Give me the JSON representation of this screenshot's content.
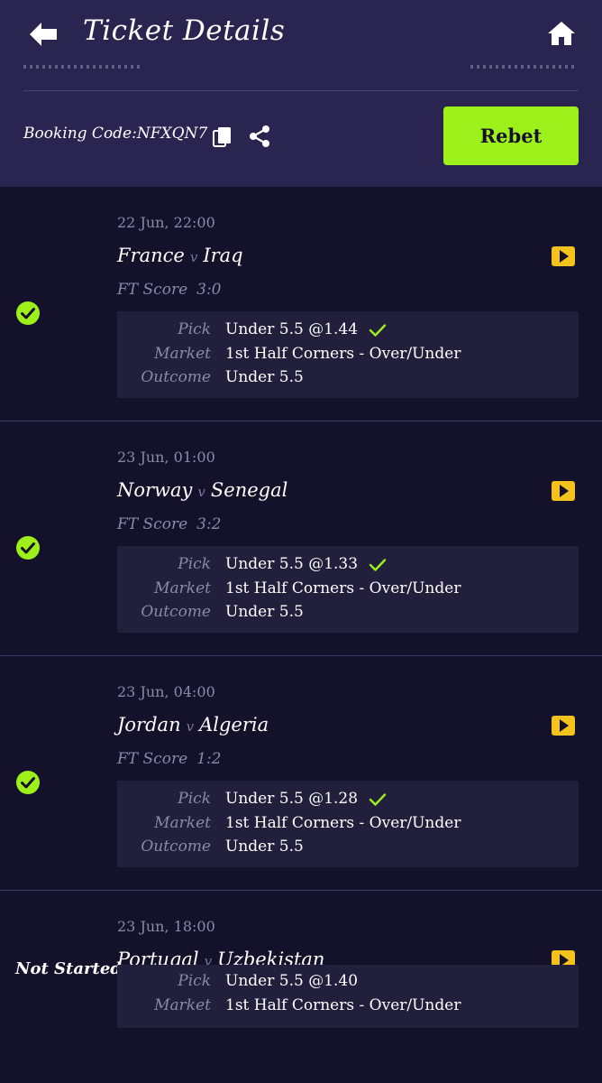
{
  "header": {
    "title": "Ticket Details"
  },
  "summary": {
    "booking_label": "Booking Code:",
    "booking_code": "NFXQN7",
    "rebet_label": "Rebet"
  },
  "matches": [
    {
      "status": "won",
      "kickoff": "22 Jun, 22:00",
      "home": "France",
      "away": "Iraq",
      "vs": "v",
      "ft_label": "FT Score",
      "ft_score": "3:0",
      "pick_label": "Pick",
      "pick": "Under 5.5 @1.44",
      "market_label": "Market",
      "market": "1st Half Corners - Over/Under",
      "outcome_label": "Outcome",
      "outcome": "Under 5.5"
    },
    {
      "status": "won",
      "kickoff": "23 Jun, 01:00",
      "home": "Norway",
      "away": "Senegal",
      "vs": "v",
      "ft_label": "FT Score",
      "ft_score": "3:2",
      "pick_label": "Pick",
      "pick": "Under 5.5 @1.33",
      "market_label": "Market",
      "market": "1st Half Corners - Over/Under",
      "outcome_label": "Outcome",
      "outcome": "Under 5.5"
    },
    {
      "status": "won",
      "kickoff": "23 Jun, 04:00",
      "home": "Jordan",
      "away": "Algeria",
      "vs": "v",
      "ft_label": "FT Score",
      "ft_score": "1:2",
      "pick_label": "Pick",
      "pick": "Under 5.5 @1.28",
      "market_label": "Market",
      "market": "1st Half Corners - Over/Under",
      "outcome_label": "Outcome",
      "outcome": "Under 5.5"
    },
    {
      "status": "not_started",
      "status_text": "Not Started",
      "kickoff": "23 Jun, 18:00",
      "home": "Portugal",
      "away": "Uzbekistan",
      "vs": "v",
      "pick_label": "Pick",
      "pick": "Under 5.5 @1.40",
      "market_label": "Market",
      "market": "1st Half Corners - Over/Under"
    }
  ],
  "colors": {
    "header_bg": "#2a2550",
    "page_bg": "#14122a",
    "accent_green": "#9ef01a",
    "expand_yellow": "#f4c21a",
    "muted_text": "#8c89a8"
  },
  "icons": {
    "back": "arrow-left-icon",
    "home": "home-icon",
    "copy": "copy-icon",
    "share": "share-icon",
    "won": "check-circle-icon",
    "pick_ok": "check-icon",
    "expand": "chevron-right-icon"
  }
}
